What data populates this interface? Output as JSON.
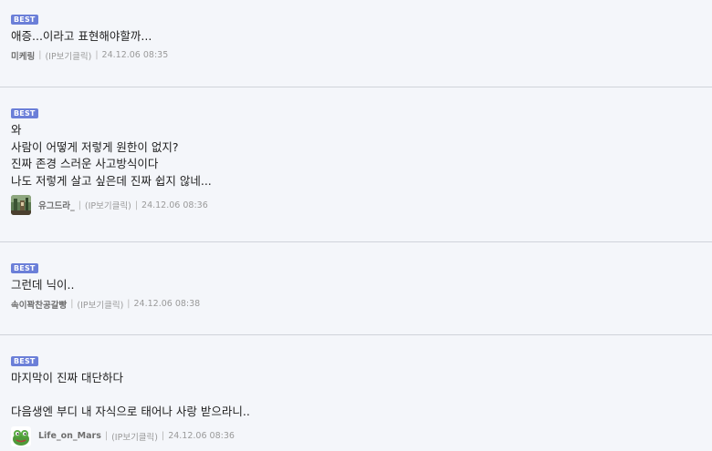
{
  "comments": [
    {
      "badge": "BEST",
      "lines": [
        "애증...이라고 표현해야할까..."
      ],
      "author": "미케링",
      "ip_label": "(IP보기클릭)",
      "timestamp": "24.12.06 08:35"
    },
    {
      "badge": "BEST",
      "lines": [
        "와",
        "사람이 어떻게 저렇게 원한이 없지?",
        "진짜 존경 스러운 사고방식이다",
        "나도 저렇게 살고 싶은데 진짜 쉽지 않네..."
      ],
      "author": "유그드라_",
      "ip_label": "(IP보기클릭)",
      "timestamp": "24.12.06 08:36",
      "avatar_icon": "forest-avatar-icon"
    },
    {
      "badge": "BEST",
      "lines": [
        "그런데 닉이.."
      ],
      "author": "속이꽉찬공갈빵",
      "ip_label": "(IP보기클릭)",
      "timestamp": "24.12.06 08:38"
    },
    {
      "badge": "BEST",
      "lines": [
        "마지막이 진짜 대단하다",
        "",
        "다음생엔 부디 내 자식으로 태어나 사랑 받으라니.."
      ],
      "author": "Life_on_Mars",
      "ip_label": "(IP보기클릭)",
      "timestamp": "24.12.06 08:36",
      "avatar_icon": "frog-avatar-icon"
    }
  ],
  "separator": "|",
  "colors": {
    "badge_bg": "#6b7fd8",
    "page_bg": "#f4f6fa",
    "divider": "#cfd3da"
  }
}
